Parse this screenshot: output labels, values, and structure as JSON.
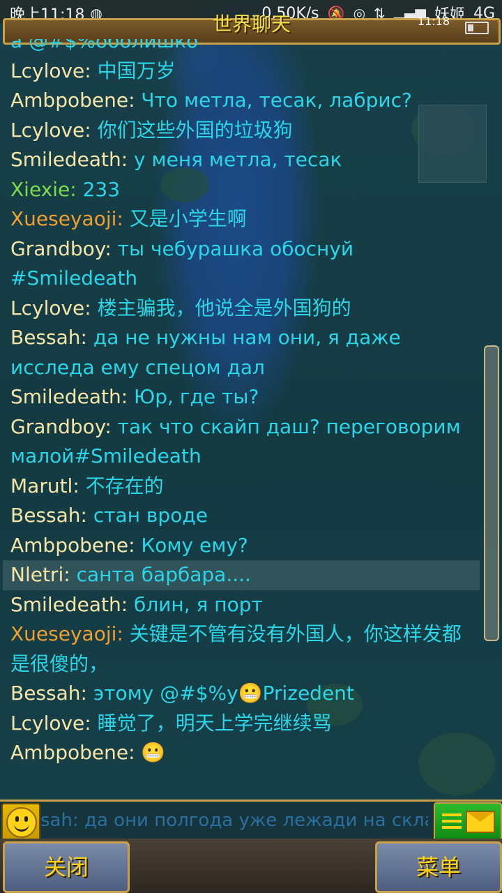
{
  "status_bar": {
    "time": "晚上11:18",
    "network_speed": "0.50K/s",
    "carrier": "妖姬",
    "network_type": "4G"
  },
  "title_bar": {
    "title": "世界聊天",
    "clock": "11:18"
  },
  "chat": {
    "messages": [
      {
        "nick": "",
        "text": "a @#$%оболишко",
        "color": "#2ad6e8",
        "highlight": false,
        "partial": true
      },
      {
        "nick": "Lcylove",
        "text": " 中国万岁",
        "color": "#f5e6a8",
        "highlight": false
      },
      {
        "nick": "Ambpobene",
        "text": " Что метла, тесак, лабрис?",
        "color": "#f5e6a8",
        "highlight": false
      },
      {
        "nick": "Lcylove",
        "text": " 你们这些外国的垃圾狗",
        "color": "#f5e6a8",
        "highlight": false
      },
      {
        "nick": "Smiledeath",
        "text": " у меня метла, тесак",
        "color": "#f5e6a8",
        "highlight": false
      },
      {
        "nick": "Xiexie",
        "text": " 233",
        "color": "#7ddc4a",
        "highlight": false
      },
      {
        "nick": "Xueseyaoji",
        "text": " 又是小学生啊",
        "color": "#f0a030",
        "highlight": false
      },
      {
        "nick": "Grandboy",
        "text": " ты чебурашка обоснуй #Smiledeath",
        "color": "#f5e6a8",
        "highlight": false
      },
      {
        "nick": "Lcylove",
        "text": " 楼主骗我，他说全是外国狗的",
        "color": "#f5e6a8",
        "highlight": false
      },
      {
        "nick": "Bessah",
        "text": " да не нужны нам они, я даже исследа ему спецом дал",
        "color": "#f5e6a8",
        "highlight": false
      },
      {
        "nick": "Smiledeath",
        "text": " Юр, где ты?",
        "color": "#f5e6a8",
        "highlight": false
      },
      {
        "nick": "Grandboy",
        "text": " так что скайп даш? переговорим малой#Smiledeath",
        "color": "#f5e6a8",
        "highlight": false
      },
      {
        "nick": "Marutl",
        "text": " 不存在的",
        "color": "#f5e6a8",
        "highlight": false
      },
      {
        "nick": "Bessah",
        "text": " стан вроде",
        "color": "#f5e6a8",
        "highlight": false
      },
      {
        "nick": "Ambpobene",
        "text": " Кому ему?",
        "color": "#f5e6a8",
        "highlight": false
      },
      {
        "nick": "Nletri",
        "text": " санта барбара....",
        "color": "#f5e6a8",
        "highlight": true
      },
      {
        "nick": "Smiledeath",
        "text": " блин, я порт",
        "color": "#f5e6a8",
        "highlight": false
      },
      {
        "nick": "Xueseyaoji",
        "text": " 关键是不管有没有外国人，你这样发都是很傻的，",
        "color": "#f0a030",
        "highlight": false
      },
      {
        "nick": "Bessah",
        "text": " этому @#$%y😬Prizedent",
        "color": "#f5e6a8",
        "highlight": false
      },
      {
        "nick": "Lcylove",
        "text": " 睡觉了，明天上学完继续骂",
        "color": "#f5e6a8",
        "highlight": false
      },
      {
        "nick": "Ambpobene",
        "text": " 😬",
        "color": "#f5e6a8",
        "highlight": false
      }
    ]
  },
  "input": {
    "value": "sah: да они полгода уже лежади на складе"
  },
  "buttons": {
    "close": "关闭",
    "menu": "菜单"
  },
  "colors": {
    "message_text": "#2ad6e8",
    "nick_default": "#f5e6a8",
    "frame_gold": "#c9a14a",
    "button_text": "#ffd21a"
  }
}
